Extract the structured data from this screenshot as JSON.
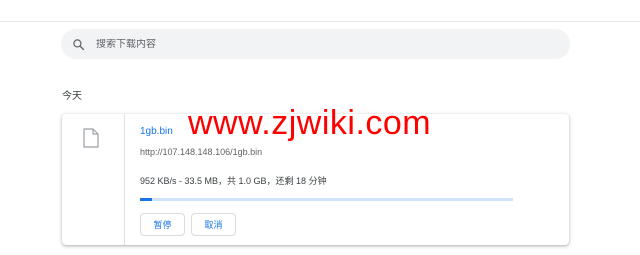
{
  "search": {
    "placeholder": "搜索下载内容",
    "icon": "search-icon"
  },
  "section": {
    "label": "今天"
  },
  "download": {
    "file_icon": "file-icon",
    "file_name": "1gb.bin",
    "url": "http://107.148.148.106/1gb.bin",
    "status": "952 KB/s - 33.5 MB，共 1.0 GB，还剩 18 分钟",
    "progress_fraction": 0.033,
    "pause_label": "暂停",
    "cancel_label": "取消"
  },
  "watermark": {
    "text": "www.zjwiki.com"
  },
  "colors": {
    "accent": "#1a73e8",
    "progress_track": "#d2e3fc",
    "watermark": "#ff0000"
  }
}
